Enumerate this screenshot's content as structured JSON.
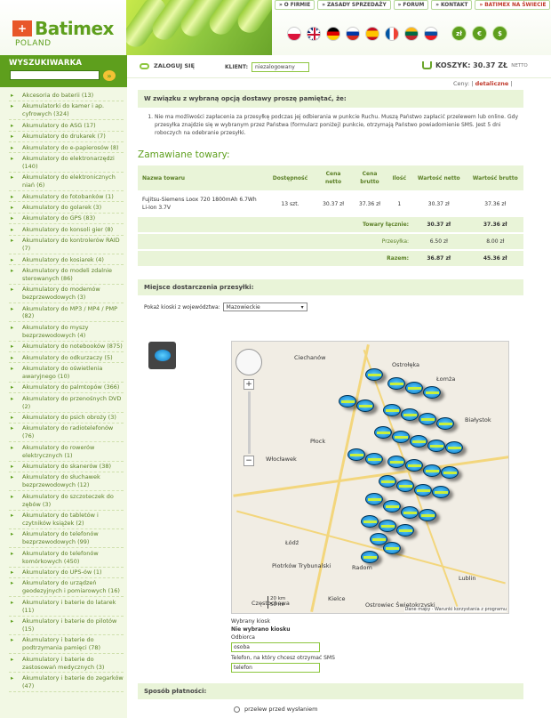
{
  "brand": {
    "name": "Batimex",
    "country": "POLAND",
    "mark": "+"
  },
  "topnav": [
    "» O FIRMIE",
    "» ZASADY SPRZEDAŻY",
    "» FORUM",
    "» KONTAKT",
    "» BATIMEX NA ŚWIECIE"
  ],
  "currency": [
    "zł",
    "€",
    "$"
  ],
  "search": {
    "title": "WYSZUKIWARKA",
    "go": "»"
  },
  "categories": [
    "Akcesoria do baterii (13)",
    "Akumulatorki do kamer i ap. cyfrowych (324)",
    "Akumulatory do ASG (17)",
    "Akumulatory do drukarek (7)",
    "Akumulatory do e-papierosów (8)",
    "Akumulatory do elektronarzędzi (140)",
    "Akumulatory do elektronicznych niań (6)",
    "Akumulatory do fotobanków (1)",
    "Akumulatory do golarek (3)",
    "Akumulatory do GPS (83)",
    "Akumulatory do konsoli gier (8)",
    "Akumulatory do kontrolerów RAID (7)",
    "Akumulatory do kosiarek (4)",
    "Akumulatory do modeli zdalnie sterowanych (86)",
    "Akumulatory do modemów bezprzewodowych (3)",
    "Akumulatory do MP3 / MP4 / PMP (82)",
    "Akumulatory do myszy bezprzewodowych (4)",
    "Akumulatory do notebooków (875)",
    "Akumulatory do odkurzaczy (5)",
    "Akumulatory do oświetlenia awaryjnego (10)",
    "Akumulatory do palmtopów (366)",
    "Akumulatory do przenośnych DVD (2)",
    "Akumulatory do psich obroży (3)",
    "Akumulatory do radiotelefonów (76)",
    "Akumulatory do rowerów elektrycznych (1)",
    "Akumulatory do skanerów (38)",
    "Akumulatory do słuchawek bezprzewodowych (12)",
    "Akumulatory do szczoteczek do zębów (3)",
    "Akumulatory do tabletów i czytników książek (2)",
    "Akumulatory do telefonów bezprzewodowych (99)",
    "Akumulatory do telefonów komórkowych (450)",
    "Akumulatory do UPS-ów (1)",
    "Akumulatory do urządzeń geodezyjnych i pomiarowych (16)",
    "Akumulatory i baterie do latarek (11)",
    "Akumulatory i baterie do pilotów (15)",
    "Akumulatory i baterie do podtrzymania pamięci (78)",
    "Akumulatory i baterie do zastosowań medycznych (3)",
    "Akumulatory i baterie do zegarków (47)"
  ],
  "userbar": {
    "login": "ZALOGUJ SIĘ",
    "client_label": "KLIENT:",
    "client_value": "niezalogowany",
    "cart": "KOSZYK: 30.37 ZŁ",
    "cart_net": "NETTO"
  },
  "pricebar": {
    "retail": "Ceny:",
    "detail": "detaliczne",
    "sep": "|"
  },
  "notice": {
    "title": "W związku z wybraną opcją dostawy proszę pamiętać, że:",
    "text": "Nie ma możliwości zapłacenia za przesyłkę podczas jej odbierania w punkcie Ruchu. Muszą Państwo zapłacić przelewem lub online. Gdy przesyłka znajdzie się w wybranym przez Państwa (formularz poniżej) punkcie, otrzymają Państwo powiadomienie SMS. Jest 5 dni roboczych na odebranie przesyłki."
  },
  "order": {
    "title": "Zamawiane towary:",
    "headers": [
      "Nazwa towaru",
      "Dostępność",
      "Cena netto",
      "Cena brutto",
      "Ilość",
      "Wartość netto",
      "Wartość brutto"
    ],
    "row": [
      "Fujitsu-Siemens Loox 720 1800mAh 6.7Wh Li-Ion 3.7V",
      "13 szt.",
      "30.37 zł",
      "37.36 zł",
      "1",
      "30.37 zł",
      "37.36 zł"
    ],
    "totals": [
      {
        "label": "Towary łącznie:",
        "net": "30.37 zł",
        "gross": "37.36 zł"
      },
      {
        "label": "Przesyłka:",
        "net": "6.50 zł",
        "gross": "8.00 zł"
      },
      {
        "label": "Razem:",
        "net": "36.87 zł",
        "gross": "45.36 zł"
      }
    ]
  },
  "delivery": {
    "title": "Miejsce dostarczenia przesyłki:",
    "woj_label": "Pokaż kioski z województwa:",
    "woj_value": "Mazowieckie"
  },
  "map": {
    "cities": [
      "Ciechanów",
      "Ostrołęka",
      "Łomża",
      "Białystok",
      "Płock",
      "Włocławek",
      "Łódź",
      "Piotrków Trybunalski",
      "Radom",
      "Lublin",
      "Kielce",
      "Ostrowiec Świętokrzyski",
      "Częstochowa"
    ],
    "scale_km": "20 km",
    "scale_mi": "50 mi",
    "credits": "Dane mapy · Warunki korzystania z programu"
  },
  "kiosk_form": {
    "chosen_label": "Wybrany kiosk",
    "chosen_value": "Nie wybrano kiosku",
    "recipient_label": "Odbiorca",
    "recipient_value": "osoba",
    "phone_label": "Telefon, na który chcesz otrzymać SMS",
    "phone_value": "telefon"
  },
  "payment": {
    "title": "Sposób płatności:",
    "option": "przelew przed wysłaniem"
  }
}
